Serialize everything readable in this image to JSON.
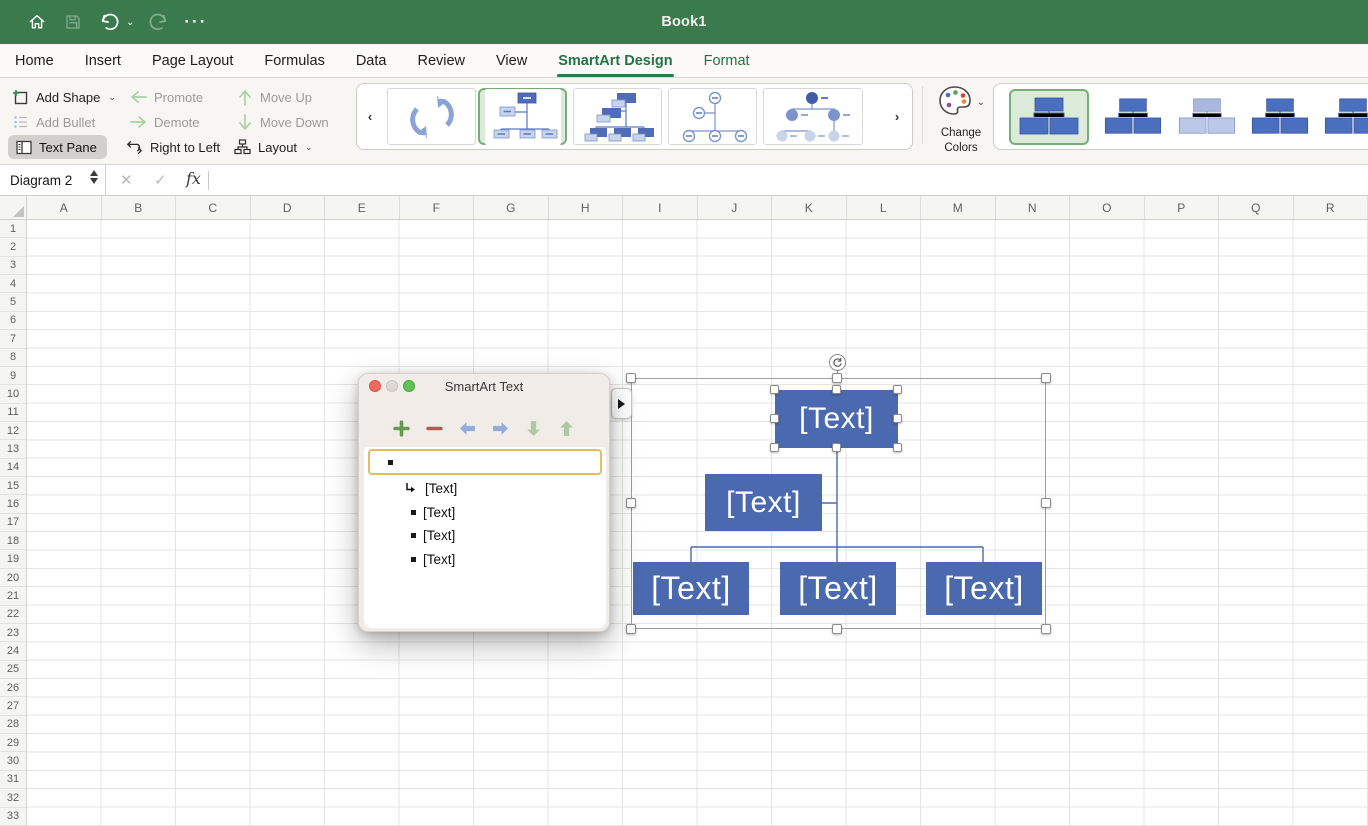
{
  "titlebar": {
    "title": "Book1",
    "icons": [
      "home-icon",
      "save-icon",
      "undo-icon",
      "redo-icon",
      "more-icon"
    ]
  },
  "tabs": [
    {
      "label": "Home"
    },
    {
      "label": "Insert"
    },
    {
      "label": "Page Layout"
    },
    {
      "label": "Formulas"
    },
    {
      "label": "Data"
    },
    {
      "label": "Review"
    },
    {
      "label": "View"
    },
    {
      "label": "SmartArt Design",
      "active": true
    },
    {
      "label": "Format",
      "accent": true
    }
  ],
  "ribbon": {
    "add_shape": "Add Shape",
    "add_bullet": "Add Bullet",
    "text_pane": "Text Pane",
    "promote": "Promote",
    "demote": "Demote",
    "right_to_left": "Right to Left",
    "move_up": "Move Up",
    "move_down": "Move Down",
    "layout": "Layout",
    "change_colors_line1": "Change",
    "change_colors_line2": "Colors",
    "disabled_buttons": [
      "Add Bullet",
      "Promote",
      "Demote",
      "Move Up",
      "Move Down"
    ],
    "layout_gallery": [
      {
        "name": "cycle"
      },
      {
        "name": "organization-chart",
        "selected": true
      },
      {
        "name": "name-and-title-organization-chart"
      },
      {
        "name": "circle-hierarchy"
      },
      {
        "name": "half-circle-organization-chart"
      }
    ],
    "color_variants": [
      {
        "name": "colorful-variant-1",
        "selected": true
      },
      {
        "name": "variant-2"
      },
      {
        "name": "variant-3-light"
      },
      {
        "name": "variant-4"
      },
      {
        "name": "variant-5"
      }
    ]
  },
  "formula_bar": {
    "name_box_value": "Diagram 2",
    "formula_value": ""
  },
  "grid": {
    "columns": [
      "A",
      "B",
      "C",
      "D",
      "E",
      "F",
      "G",
      "H",
      "I",
      "J",
      "K",
      "L",
      "M",
      "N",
      "O",
      "P",
      "Q",
      "R"
    ],
    "row_count": 33
  },
  "text_pane": {
    "title": "SmartArt Text",
    "input_value": "",
    "entries": [
      {
        "marker": "assistant",
        "text": "[Text]"
      },
      {
        "marker": "bullet",
        "text": "[Text]"
      },
      {
        "marker": "bullet",
        "text": "[Text]"
      },
      {
        "marker": "bullet",
        "text": "[Text]"
      }
    ]
  },
  "diagram": {
    "top": "[Text]",
    "assistant": "[Text]",
    "children": [
      "[Text]",
      "[Text]",
      "[Text]"
    ]
  },
  "colors": {
    "titlebar_green": "#3b7a4c",
    "accent_green": "#217346",
    "smartart_box_blue": "#4a69af",
    "connector_blue": "#4a69ad",
    "selected_thumb_border": "#77ae77",
    "selected_thumb_bg": "#dcead9",
    "text_pane_highlight_border": "#e5bc60"
  }
}
